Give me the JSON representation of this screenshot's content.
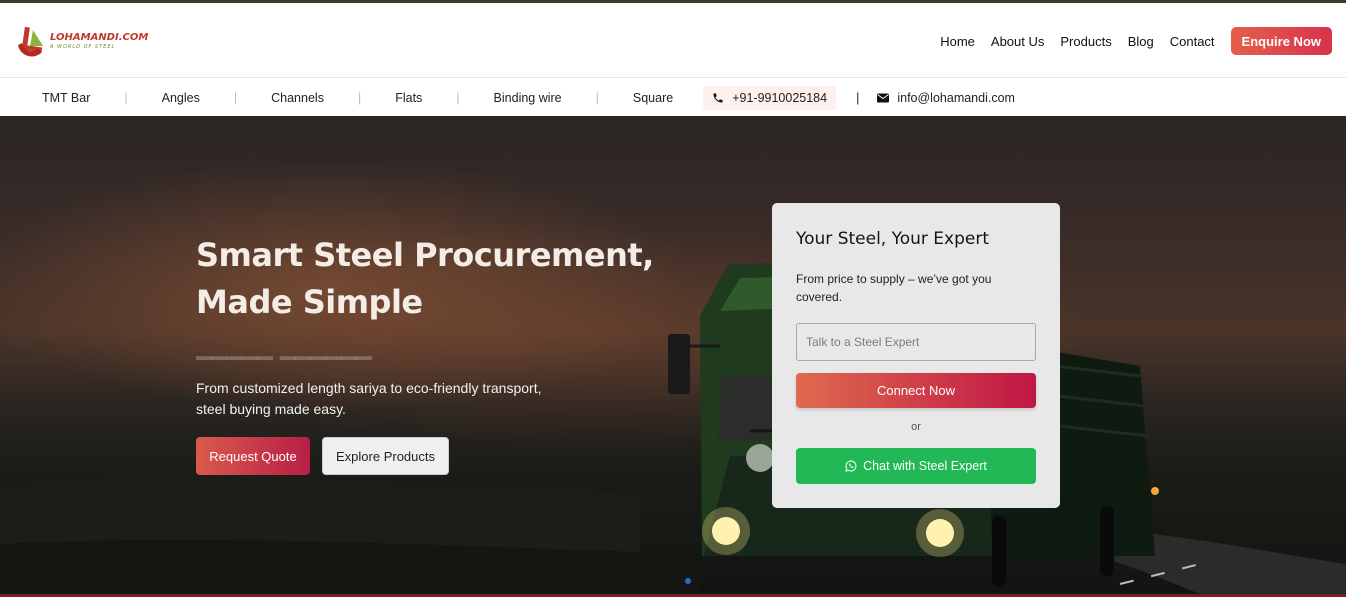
{
  "brand": {
    "name": "LOHAMANDI.COM",
    "tagline": "A WORLD OF STEEL"
  },
  "nav": {
    "items": [
      {
        "label": "Home"
      },
      {
        "label": "About Us"
      },
      {
        "label": "Products"
      },
      {
        "label": "Blog"
      },
      {
        "label": "Contact"
      }
    ],
    "cta_label": "Enquire Now"
  },
  "subnav": {
    "categories": [
      {
        "label": "TMT Bar"
      },
      {
        "label": "Angles"
      },
      {
        "label": "Channels"
      },
      {
        "label": "Flats"
      },
      {
        "label": "Binding wire"
      },
      {
        "label": "Square"
      }
    ],
    "phone": "+91-9910025184",
    "email": "info@lohamandi.com"
  },
  "hero": {
    "title_line1": "Smart Steel Procurement,",
    "title_line2": "Made Simple",
    "subtitle": "From customized length sariya to eco-friendly transport, steel buying made easy.",
    "quote_button": "Request Quote",
    "explore_button": "Explore Products"
  },
  "card": {
    "title": "Your Steel, Your Expert",
    "description": "From price to supply – we’ve got you covered.",
    "input_placeholder": "Talk to a Steel Expert",
    "connect_button": "Connect Now",
    "or_text": "or",
    "whatsapp_button": "Chat with Steel Expert"
  },
  "colors": {
    "accent_start": "#e45f4c",
    "accent_end": "#c01645",
    "whatsapp": "#22b855",
    "carousel_dot": "#1e6fd9"
  },
  "icons": [
    "logo-mark",
    "phone-icon",
    "mail-icon",
    "whatsapp-icon"
  ]
}
